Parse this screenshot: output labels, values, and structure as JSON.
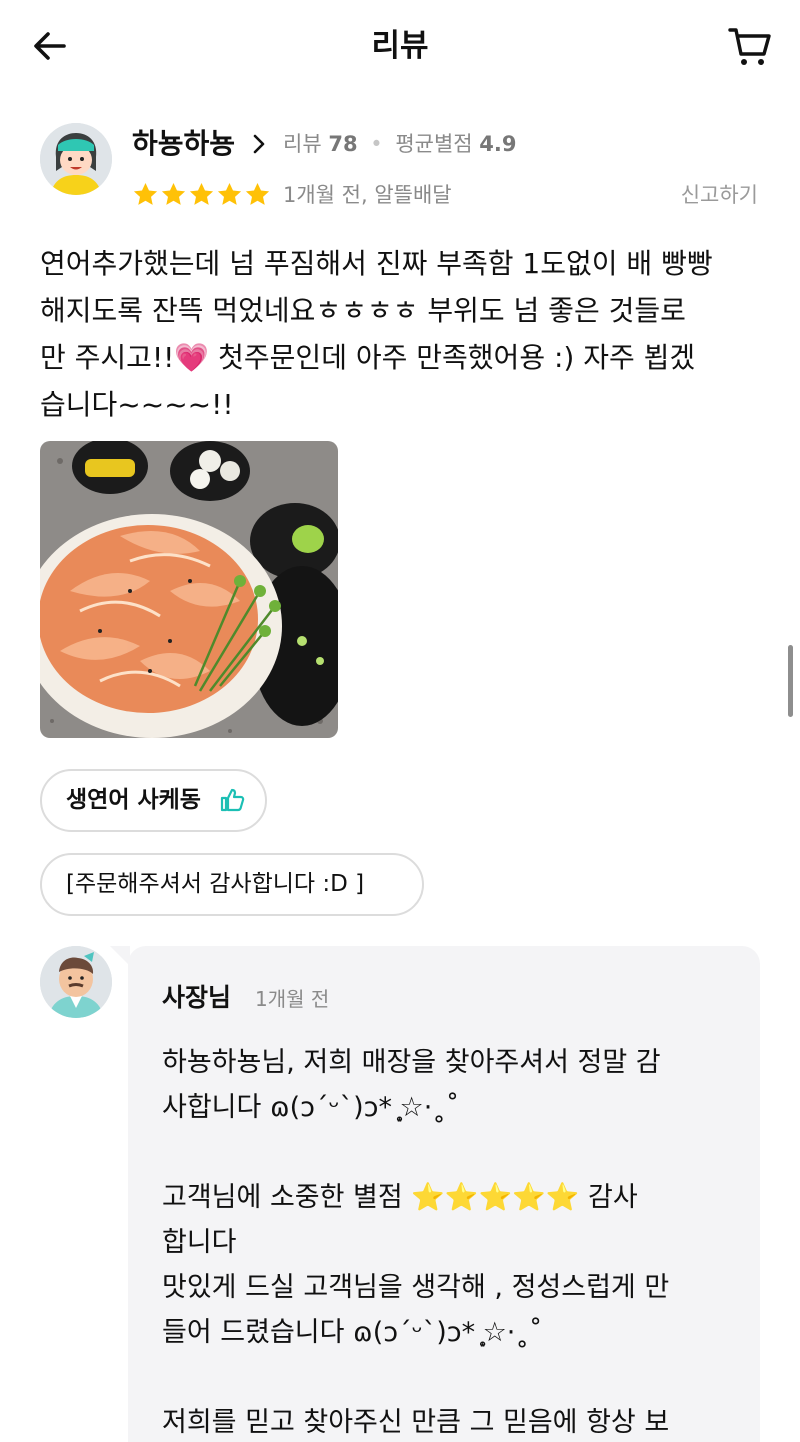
{
  "header": {
    "title": "리뷰",
    "back_icon": "arrow-left-icon",
    "cart_icon": "cart-icon"
  },
  "review": {
    "user_name": "하뇽하뇽",
    "stats_review_label": "리뷰",
    "stats_review_count": "78",
    "stats_rating_label": "평균별점",
    "stats_rating_value": "4.9",
    "rating": 5,
    "meta": "1개월 전, 알뜰배달",
    "report_label": "신고하기",
    "text": "연어추가했는데 넘 푸짐해서 진짜 부족함 1도없이 배 빵빵\n해지도록 잔뜩 먹었네요ㅎㅎㅎㅎ 부위도 넘 좋은 것들로\n만 주시고!!💗 첫주문인데 아주 만족했어용 :) 자주 뵙겠\n습니다~~~~!!",
    "menu_chip": "생연어 사케동",
    "thanks_chip": "[주문해주셔서 감사합니다 :D ]",
    "colors": {
      "star": "#ffc107",
      "like_icon": "#1bbfb4"
    }
  },
  "reply": {
    "owner_name": "사장님",
    "time": "1개월 전",
    "text": "하뇽하뇽님, 저희 매장을 찾아주셔서 정말 감\n사합니다 ɷ(ↄ´ᵕ`)ↄ* ̥͙☆·˳˚\n\n고객님에 소중한 별점 ⭐⭐⭐⭐⭐ 감사\n합니다\n맛있게 드실 고객님을 생각해 , 정성스럽게 만\n들어 드렸습니다 ɷ(ↄ´ᵕ`)ↄ* ̥͙☆·˳˚\n\n저희를 믿고 찾아주신 만큼 그 믿음에 항상 보"
  }
}
